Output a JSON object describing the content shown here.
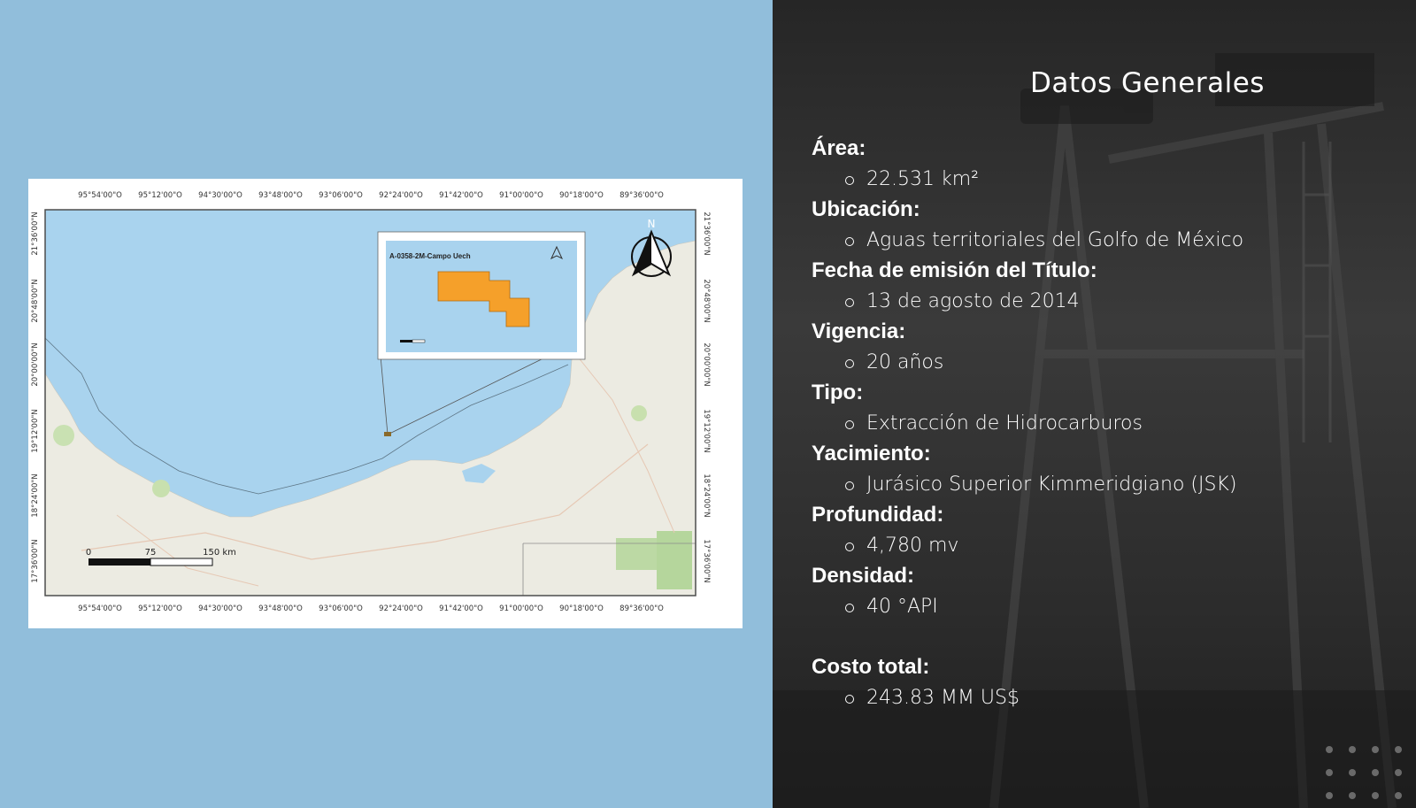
{
  "colors": {
    "background_blue": "#91bedb",
    "sea": "#a9d3ee",
    "land": "#eceae1",
    "block": "#f5a02a",
    "panel_dark": "#2f2f2f"
  },
  "map": {
    "top_ticks": [
      "95°54'00\"O",
      "95°12'00\"O",
      "94°30'00\"O",
      "93°48'00\"O",
      "93°06'00\"O",
      "92°24'00\"O",
      "91°42'00\"O",
      "91°00'00\"O",
      "90°18'00\"O",
      "89°36'00\"O"
    ],
    "bottom_ticks": [
      "95°54'00\"O",
      "95°12'00\"O",
      "94°30'00\"O",
      "93°48'00\"O",
      "93°06'00\"O",
      "92°24'00\"O",
      "91°42'00\"O",
      "91°00'00\"O",
      "90°18'00\"O",
      "89°36'00\"O"
    ],
    "side_ticks": [
      "21°36'00\"N",
      "20°48'00\"N",
      "20°00'00\"N",
      "19°12'00\"N",
      "18°24'00\"N",
      "17°36'00\"N"
    ],
    "north_label": "N",
    "north_arrow_icon": "north-arrow-icon",
    "scale": {
      "zero": "0",
      "mid": "75",
      "end": "150 km"
    },
    "inset": {
      "title": "A-0358-2M-Campo Uech"
    }
  },
  "panel": {
    "title": "Datos Generales",
    "items": [
      {
        "label": "Área:",
        "value": "22.531 km²"
      },
      {
        "label": "Ubicación:",
        "value": "Aguas territoriales del Golfo de México"
      },
      {
        "label": "Fecha de emisión del Título:",
        "value": "13 de agosto de 2014"
      },
      {
        "label": "Vigencia:",
        "value": "20 años"
      },
      {
        "label": "Tipo:",
        "value": "Extracción de Hidrocarburos"
      },
      {
        "label": "Yacimiento:",
        "value": "Jurásico Superior Kimmeridgiano (JSK)"
      },
      {
        "label": "Profundidad:",
        "value": "4,780 mv"
      },
      {
        "label": "Densidad:",
        "value": "40 °API"
      }
    ],
    "cost": {
      "label": "Costo total:",
      "value": "243.83 MM US$"
    }
  }
}
